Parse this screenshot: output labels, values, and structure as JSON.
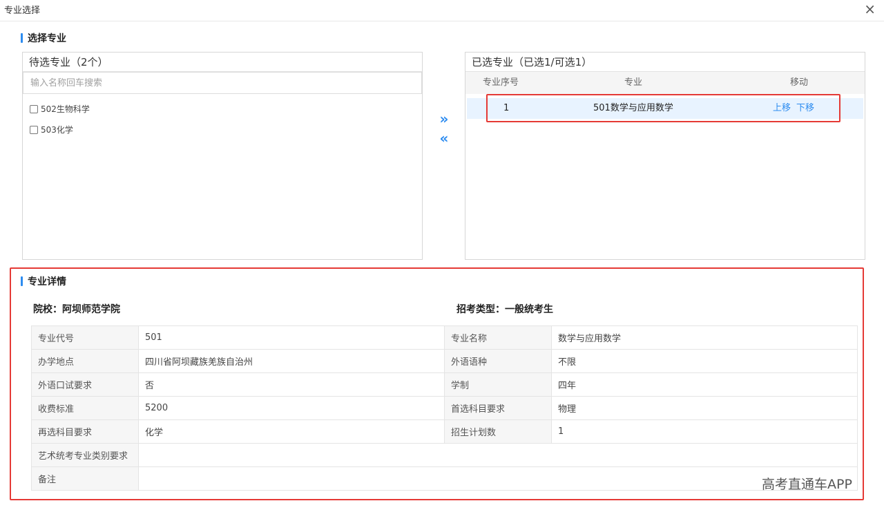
{
  "window": {
    "title": "专业选择",
    "close_glyph": "×"
  },
  "select_section": {
    "heading": "选择专业"
  },
  "pending": {
    "title": "待选专业（2个）",
    "search_placeholder": "输入名称回车搜索",
    "items": [
      {
        "label": "502生物科学",
        "checked": false
      },
      {
        "label": "503化学",
        "checked": false
      }
    ]
  },
  "transfer": {
    "add_glyph": "»",
    "remove_glyph": "«"
  },
  "selected": {
    "title": "已选专业（已选1/可选1）",
    "columns": {
      "index": "专业序号",
      "major": "专业",
      "move": "移动"
    },
    "rows": [
      {
        "index": "1",
        "major": "501数学与应用数学",
        "move_up": "上移",
        "move_down": "下移"
      }
    ]
  },
  "detail_section": {
    "heading": "专业详情",
    "school": "院校：阿坝师范学院",
    "exam_type": "招考类型：一般统考生",
    "rows": [
      {
        "l1": "专业代号",
        "v1": "501",
        "l2": "专业名称",
        "v2": "数学与应用数学"
      },
      {
        "l1": "办学地点",
        "v1": "四川省阿坝藏族羌族自治州",
        "l2": "外语语种",
        "v2": "不限"
      },
      {
        "l1": "外语口试要求",
        "v1": "否",
        "l2": "学制",
        "v2": "四年"
      },
      {
        "l1": "收费标准",
        "v1": "5200",
        "l2": "首选科目要求",
        "v2": "物理"
      },
      {
        "l1": "再选科目要求",
        "v1": "化学",
        "l2": "招生计划数",
        "v2": "1"
      }
    ],
    "wide_rows": [
      {
        "label": "艺术统考专业类别要求",
        "value": ""
      },
      {
        "label": "备注",
        "value": ""
      }
    ]
  },
  "watermark": "高考直通车APP",
  "colors": {
    "accent": "#2d8cf0",
    "highlight": "#e53935",
    "selected_row": "#e8f3ff"
  }
}
